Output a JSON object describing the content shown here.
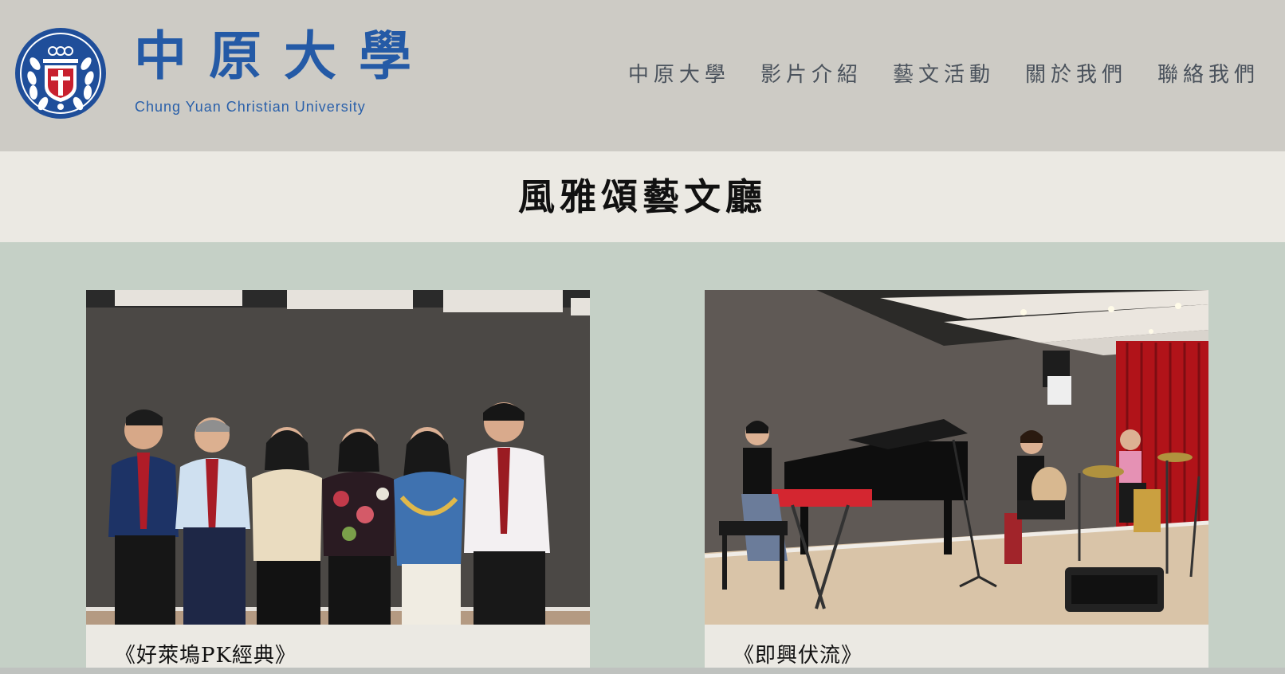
{
  "header": {
    "logo_text_cn": "中原大學",
    "logo_text_en": "Chung Yuan Christian University",
    "nav": [
      {
        "label": "中原大學"
      },
      {
        "label": "影片介紹"
      },
      {
        "label": "藝文活動"
      },
      {
        "label": "關於我們"
      },
      {
        "label": "聯絡我們"
      }
    ]
  },
  "page": {
    "title": "風雅頌藝文廳"
  },
  "cards": [
    {
      "caption": "《好萊塢PK經典》",
      "image": "group-photo-six-people"
    },
    {
      "caption": "《即興伏流》",
      "image": "concert-stage-performance"
    }
  ],
  "colors": {
    "header_bg": "#cdcbc5",
    "title_band_bg": "#ebe9e3",
    "page_bg": "#c5d0c6",
    "brand_blue": "#245aa6",
    "nav_text": "#4a525c"
  }
}
